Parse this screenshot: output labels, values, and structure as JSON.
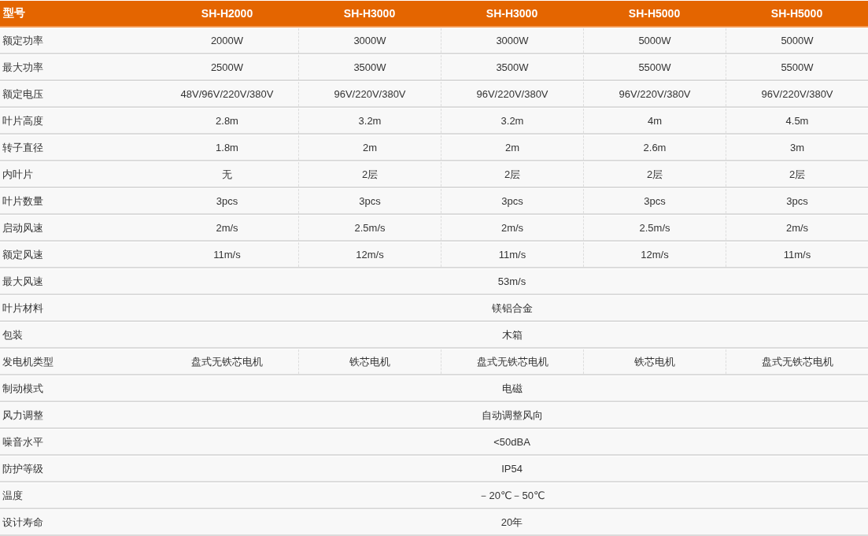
{
  "table": {
    "header": {
      "label": "型号",
      "models": [
        "SH-H2000",
        "SH-H3000",
        "SH-H3000",
        "SH-H5000",
        "SH-H5000"
      ]
    },
    "rows": [
      {
        "label": "额定功率",
        "cells": [
          "2000W",
          "3000W",
          "3000W",
          "5000W",
          "5000W"
        ]
      },
      {
        "label": "最大功率",
        "cells": [
          "2500W",
          "3500W",
          "3500W",
          "5500W",
          "5500W"
        ]
      },
      {
        "label": "额定电压",
        "cells": [
          "48V/96V/220V/380V",
          "96V/220V/380V",
          "96V/220V/380V",
          "96V/220V/380V",
          "96V/220V/380V"
        ]
      },
      {
        "label": "叶片高度",
        "cells": [
          "2.8m",
          "3.2m",
          "3.2m",
          "4m",
          "4.5m"
        ]
      },
      {
        "label": "转子直径",
        "cells": [
          "1.8m",
          "2m",
          "2m",
          "2.6m",
          "3m"
        ]
      },
      {
        "label": "内叶片",
        "cells": [
          "无",
          "2层",
          "2层",
          "2层",
          "2层"
        ]
      },
      {
        "label": "叶片数量",
        "cells": [
          "3pcs",
          "3pcs",
          "3pcs",
          "3pcs",
          "3pcs"
        ]
      },
      {
        "label": "启动风速",
        "cells": [
          "2m/s",
          "2.5m/s",
          "2m/s",
          "2.5m/s",
          "2m/s"
        ]
      },
      {
        "label": "额定风速",
        "cells": [
          "11m/s",
          "12m/s",
          "11m/s",
          "12m/s",
          "11m/s"
        ]
      },
      {
        "label": "最大风速",
        "cells": [
          "53m/s"
        ]
      },
      {
        "label": "叶片材料",
        "cells": [
          "镁铝合金"
        ]
      },
      {
        "label": "包装",
        "cells": [
          "木箱"
        ]
      },
      {
        "label": "发电机类型",
        "cells": [
          "盘式无铁芯电机",
          "铁芯电机",
          "盘式无铁芯电机",
          "铁芯电机",
          "盘式无铁芯电机"
        ]
      },
      {
        "label": "制动模式",
        "cells": [
          "电磁"
        ]
      },
      {
        "label": "风力调整",
        "cells": [
          "自动调整风向"
        ]
      },
      {
        "label": "噪音水平",
        "cells": [
          "<50dBA"
        ]
      },
      {
        "label": "防护等级",
        "cells": [
          "IP54"
        ]
      },
      {
        "label": "温度",
        "cells": [
          "－20℃－50℃"
        ]
      },
      {
        "label": "设计寿命",
        "cells": [
          "20年"
        ]
      }
    ]
  }
}
